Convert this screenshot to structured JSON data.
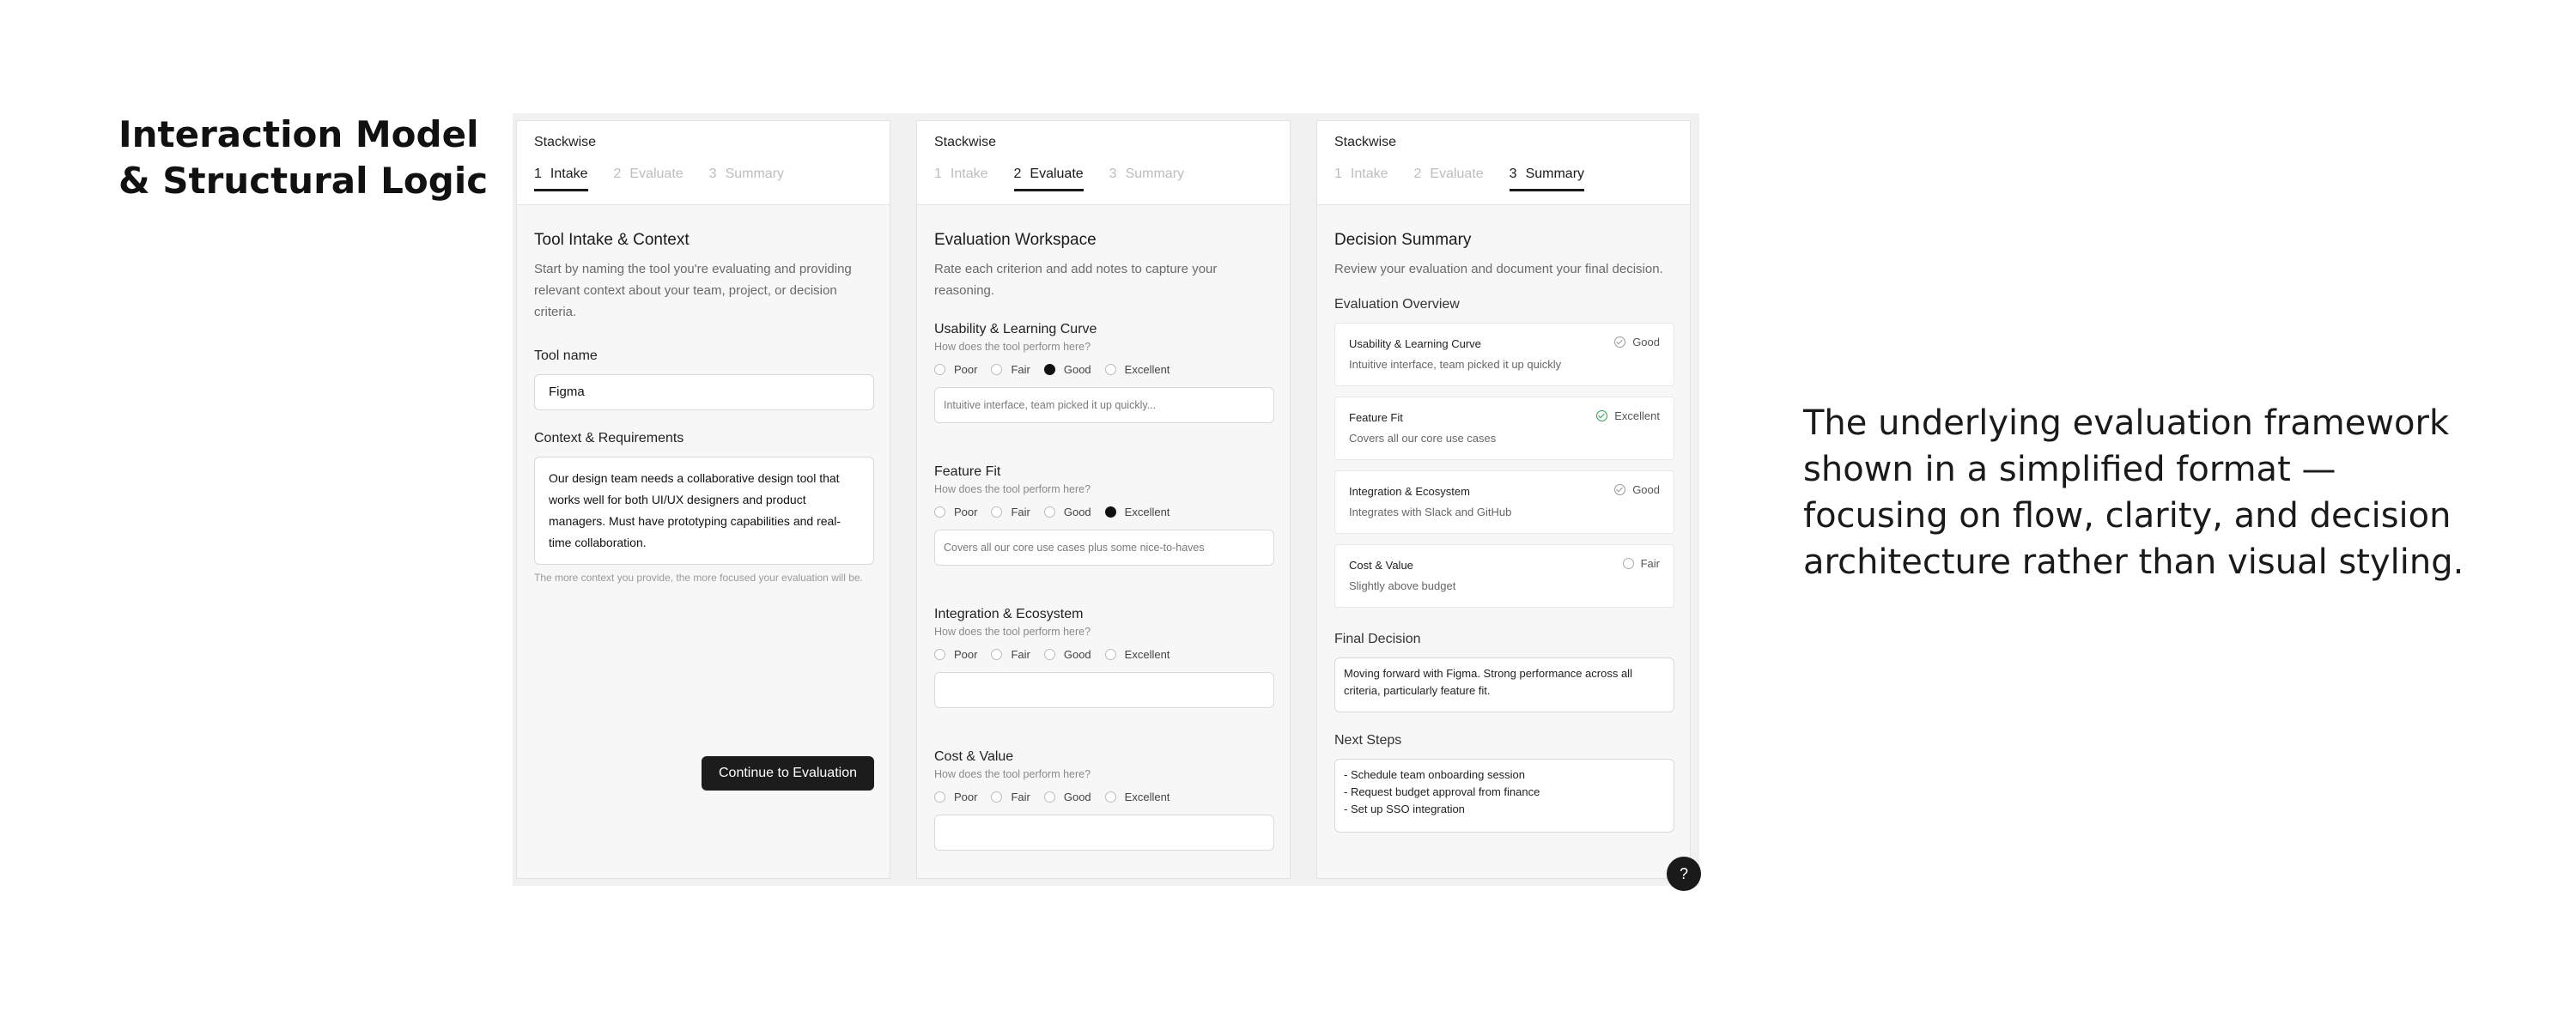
{
  "headline": {
    "line1": "Interaction Model",
    "line2": "& Structural Logic"
  },
  "caption": {
    "line1": "The underlying evaluation framework",
    "line2": "shown in a simplified format —",
    "line3": "focusing on flow, clarity, and decision",
    "line4": "architecture rather than visual styling."
  },
  "app": {
    "brand": "Stackwise",
    "tabs": [
      {
        "num": "1",
        "label": "Intake"
      },
      {
        "num": "2",
        "label": "Evaluate"
      },
      {
        "num": "3",
        "label": "Summary"
      }
    ],
    "help_label": "?"
  },
  "intake": {
    "title": "Tool Intake & Context",
    "subtitle": "Start by naming the tool you're evaluating and providing relevant context about your team, project, or decision criteria.",
    "tool_name_label": "Tool name",
    "tool_name_value": "Figma",
    "context_label": "Context & Requirements",
    "context_value": "Our design team needs a collaborative design tool that works well for both UI/UX designers and product managers. Must have prototyping capabilities and real-time collaboration.",
    "hint": "The more context you provide, the more focused your evaluation will be.",
    "continue_button": "Continue to Evaluation"
  },
  "evaluate": {
    "title": "Evaluation Workspace",
    "subtitle": "Rate each criterion and add notes to capture your reasoning.",
    "question": "How does the tool perform here?",
    "options": [
      "Poor",
      "Fair",
      "Good",
      "Excellent"
    ],
    "criteria": [
      {
        "name": "Usability & Learning Curve",
        "selected": "Good",
        "note": "Intuitive interface, team picked it up quickly..."
      },
      {
        "name": "Feature Fit",
        "selected": "Excellent",
        "note": "Covers all our core use cases plus some nice-to-haves"
      },
      {
        "name": "Integration & Ecosystem",
        "selected": "",
        "note": ""
      },
      {
        "name": "Cost & Value",
        "selected": "",
        "note": ""
      }
    ]
  },
  "summary": {
    "title": "Decision Summary",
    "subtitle": "Review your evaluation and document your final decision.",
    "overview_label": "Evaluation Overview",
    "items": [
      {
        "name": "Usability & Learning Curve",
        "rating": "Good",
        "note": "Intuitive interface, team picked it up quickly",
        "icon": "check-circle-icon",
        "color": "#999999"
      },
      {
        "name": "Feature Fit",
        "rating": "Excellent",
        "note": "Covers all our core use cases",
        "icon": "check-circle-icon",
        "color": "#2e9d4a"
      },
      {
        "name": "Integration & Ecosystem",
        "rating": "Good",
        "note": "Integrates with Slack and GitHub",
        "icon": "check-circle-icon",
        "color": "#999999"
      },
      {
        "name": "Cost & Value",
        "rating": "Fair",
        "note": "Slightly above budget",
        "icon": "empty-circle-icon",
        "color": "#aaaaaa"
      }
    ],
    "final_decision_label": "Final Decision",
    "final_decision_value": "Moving forward with Figma. Strong performance across all criteria, particularly feature fit.",
    "next_steps_label": "Next Steps",
    "next_steps": [
      "- Schedule team onboarding session",
      "- Request budget approval from finance",
      "- Set up SSO integration"
    ]
  }
}
